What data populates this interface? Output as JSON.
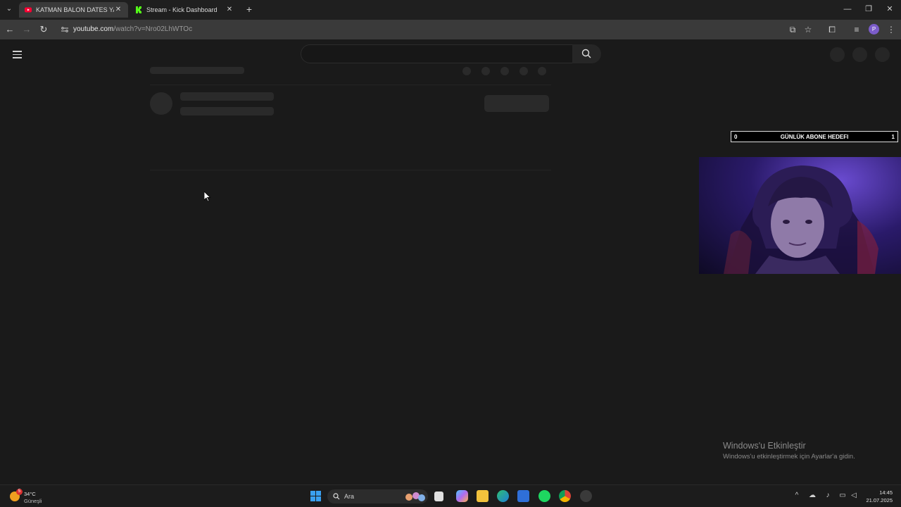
{
  "browser": {
    "tabs": [
      {
        "title": "KATMAN BALON DATES YARIŞMA",
        "close": "✕",
        "favicon": "youtube-icon",
        "color": "#ff0033"
      },
      {
        "title": "Stream - Kick Dashboard",
        "close": "✕",
        "favicon": "kick-icon",
        "color": "#53fc18"
      }
    ],
    "new_tab": "+",
    "window_controls": {
      "minimize": "—",
      "maximize": "❐",
      "close": "✕"
    },
    "url_host": "youtube.com",
    "url_path": "/watch?v=Nro02LhWTOc",
    "profile_initial": "P"
  },
  "overlay": {
    "goal": {
      "min": "0",
      "label": "GÜNLÜK ABONE HEDEFI",
      "max": "1",
      "progress": 0
    }
  },
  "activation": {
    "title": "Windows'u Etkinleştir",
    "subtitle": "Windows'u etkinleştirmek için Ayarlar'a gidin."
  },
  "taskbar": {
    "weather": {
      "badge": "5",
      "temp": "34°C",
      "condition": "Güneşli"
    },
    "search_placeholder": "Ara",
    "time": "14:45",
    "date": "21.07.2025"
  },
  "colors": {
    "page_bg": "#1a1a1a",
    "skeleton": "#2a2a2a",
    "accent": "#7b5cc9"
  }
}
